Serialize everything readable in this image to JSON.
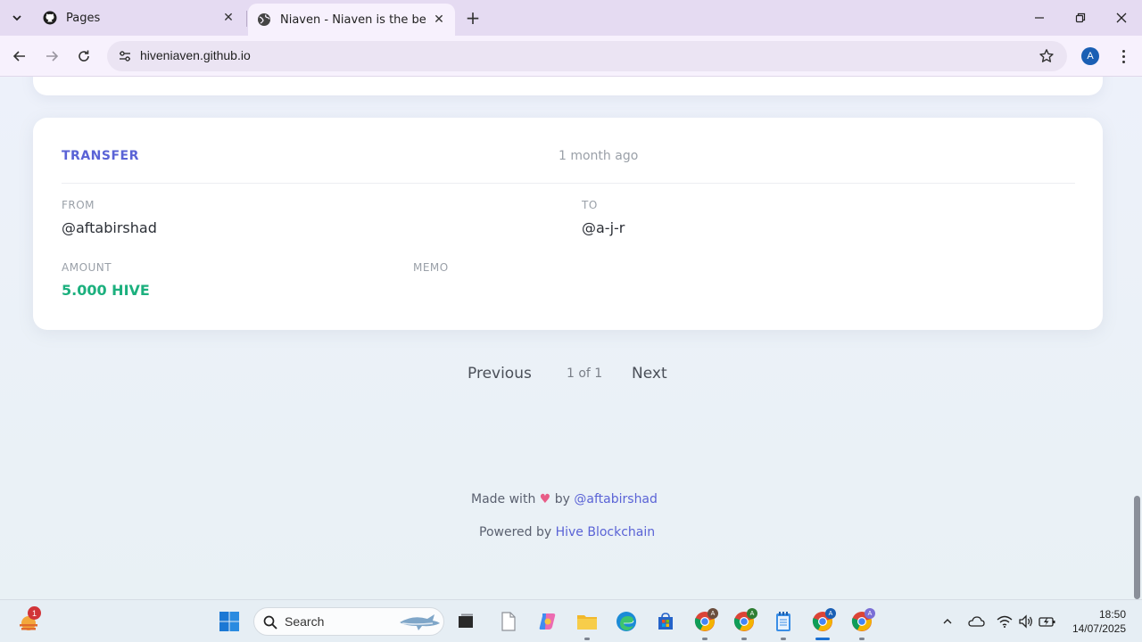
{
  "browser": {
    "tabs": [
      {
        "title": "Pages",
        "active": false,
        "icon": "github-icon"
      },
      {
        "title": "Niaven - Niaven is the best platform",
        "active": true,
        "icon": "globe-icon"
      }
    ],
    "url": "hiveniaven.github.io",
    "profile_initial": "A"
  },
  "transaction": {
    "type": "TRANSFER",
    "time": "1 month ago",
    "from_label": "FROM",
    "from_value": "@aftabirshad",
    "to_label": "TO",
    "to_value": "@a-j-r",
    "amount_label": "AMOUNT",
    "amount_value": "5.000 HIVE",
    "memo_label": "MEMO",
    "memo_value": ""
  },
  "pagination": {
    "previous": "Previous",
    "info": "1 of 1",
    "next": "Next"
  },
  "footer": {
    "made_with": "Made with",
    "heart": "♥",
    "by": "by",
    "author": "@aftabirshad",
    "powered_by": "Powered by",
    "powered_link": "Hive Blockchain"
  },
  "taskbar": {
    "weather_badge": "1",
    "search_placeholder": "Search",
    "clock_time": "18:50",
    "clock_date": "14/07/2025",
    "chrome_profiles": [
      "A",
      "A",
      "A",
      "A"
    ]
  },
  "colors": {
    "accent": "#5a63d6",
    "amount": "#1cb07e",
    "muted": "#9aa0a8"
  }
}
